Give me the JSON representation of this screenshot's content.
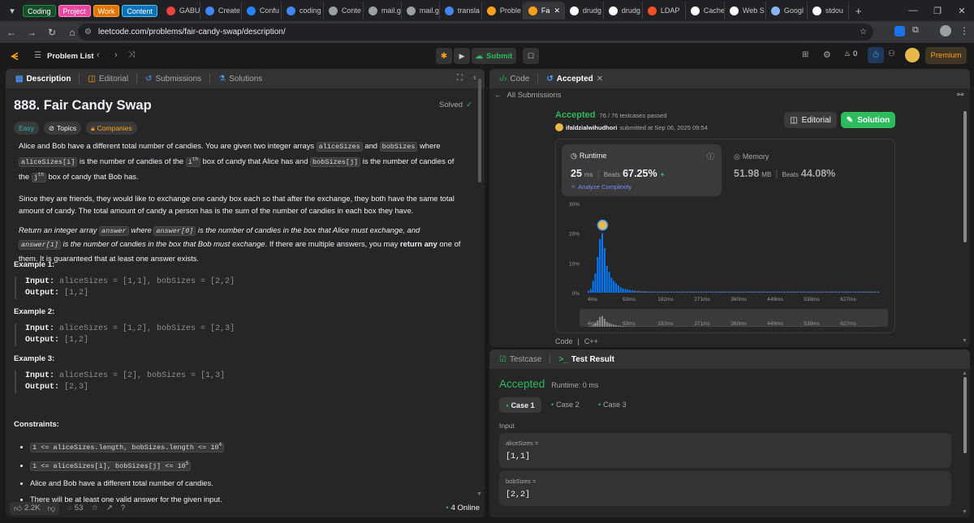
{
  "browser": {
    "tab_groups": [
      {
        "label": "Coding",
        "color": "#1e8e3e",
        "bg": "#174c2c"
      },
      {
        "label": "Project",
        "color": "#ff8bcb",
        "bg": "#e8479f"
      },
      {
        "label": "Work",
        "color": "#f9a825",
        "bg": "#e37400"
      },
      {
        "label": "Content",
        "color": "#4fc3f7",
        "bg": "#0b72b8"
      }
    ],
    "tabs": [
      {
        "label": "GABUI",
        "icon": "mail-icon",
        "color": "#e8453c"
      },
      {
        "label": "Create",
        "icon": "globe-icon",
        "color": "#4285f4"
      },
      {
        "label": "Confu",
        "icon": "confluence-icon",
        "color": "#2684ff"
      },
      {
        "label": "coding",
        "icon": "coding-icon",
        "color": "#4285f4"
      },
      {
        "label": "Conte",
        "icon": "doc-icon",
        "color": "#9aa0a6"
      },
      {
        "label": "mail.g",
        "icon": "globe-icon",
        "color": "#9aa0a6"
      },
      {
        "label": "mail.g",
        "icon": "globe-icon",
        "color": "#9aa0a6"
      },
      {
        "label": "transla",
        "icon": "google-icon",
        "color": "#4285f4"
      },
      {
        "label": "Proble",
        "icon": "leetcode-icon",
        "color": "#ffa116"
      },
      {
        "label": "Fa",
        "icon": "leetcode-icon",
        "color": "#ffa116"
      },
      {
        "label": "drudg",
        "icon": "github-icon",
        "color": "#ffffff"
      },
      {
        "label": "drudg",
        "icon": "github-icon",
        "color": "#ffffff"
      },
      {
        "label": "LDAP",
        "icon": "ms-icon",
        "color": "#f25022"
      },
      {
        "label": "Cache",
        "icon": "medium-icon",
        "color": "#ffffff"
      },
      {
        "label": "Web S",
        "icon": "medium-icon",
        "color": "#ffffff"
      },
      {
        "label": "Googl",
        "icon": "gemini-icon",
        "color": "#8ab4f8"
      },
      {
        "label": "stdou",
        "icon": "github-icon",
        "color": "#ffffff"
      }
    ],
    "url": "leetcode.com/problems/fair-candy-swap/description/"
  },
  "lc_nav": {
    "problem_list": "Problem List",
    "submit": "Submit",
    "streak": "0",
    "premium": "Premium"
  },
  "left_panel": {
    "tabs": [
      "Description",
      "Editorial",
      "Submissions",
      "Solutions"
    ],
    "title": "888. Fair Candy Swap",
    "solved": "Solved",
    "difficulty": "Easy",
    "topics": "Topics",
    "companies": "Companies",
    "p1": {
      "a": "Alice and Bob have a different total number of candies. You are given two integer arrays ",
      "c1": "aliceSizes",
      "b": " and ",
      "c2": "bobSizes",
      "c": " where ",
      "c3": "aliceSizes[i]",
      "d": " is",
      "e": "the number of candies of the ",
      "sup1": "i",
      "sup1b": "th",
      "f": " box of candy that Alice has and ",
      "c4": "bobSizes[j]",
      "g": " is the number of candies of the ",
      "sup2": "j",
      "sup2b": "th",
      "h": " box of candy that Bob has."
    },
    "p2": "Since they are friends, they would like to exchange one candy box each so that after the exchange, they both have the same total amount of candy. The total amount of candy a person has is the sum of the number of candies in each box they have.",
    "p3": {
      "a": "Return an integer array ",
      "c1": "answer",
      "b": " where ",
      "c2": "answer[0]",
      "c": " is the number of candies in the box that Alice must exchange, and ",
      "c3": "answer[1]",
      "d": " is the number of",
      "e": "candies in the box that Bob must exchange",
      "f": ". If there are multiple answers, you may ",
      "g": "return any",
      "h": " one of them. It is guaranteed that at least one answer exists."
    },
    "examples": [
      {
        "title": "Example 1:",
        "input_label": "Input:",
        "input": "aliceSizes = [1,1], bobSizes = [2,2]",
        "output_label": "Output:",
        "output": "[1,2]"
      },
      {
        "title": "Example 2:",
        "input_label": "Input:",
        "input": "aliceSizes = [1,2], bobSizes = [2,3]",
        "output_label": "Output:",
        "output": "[1,2]"
      },
      {
        "title": "Example 3:",
        "input_label": "Input:",
        "input": "aliceSizes = [2], bobSizes = [1,3]",
        "output_label": "Output:",
        "output": "[2,3]"
      }
    ],
    "constraints_title": "Constraints:",
    "constraints": [
      {
        "code": "1 <= aliceSizes.length, bobSizes.length <= 10",
        "sup": "4"
      },
      {
        "code": "1 <= aliceSizes[i], bobSizes[j] <= 10",
        "sup": "5"
      },
      {
        "text": "Alice and Bob have a different total number of candies."
      },
      {
        "text": "There will be at least one valid answer for the given input."
      }
    ],
    "footer": {
      "likes": "2.2K",
      "comments": "53",
      "online": "4 Online"
    }
  },
  "right_top": {
    "tabs": [
      "Code",
      "Accepted"
    ],
    "back": "All Submissions",
    "status": "Accepted",
    "passed": "76 / 76 testcases passed",
    "user": "ifaldzialwihudhori",
    "submitted": "submitted at Sep 06, 2025 09:54",
    "editorial": "Editorial",
    "solution": "Solution",
    "runtime": {
      "label": "Runtime",
      "value": "25",
      "unit": "ms",
      "beats_label": "Beats",
      "beats": "67.25%",
      "analyze": "Analyze Complexity"
    },
    "memory": {
      "label": "Memory",
      "value": "51.98",
      "unit": "MB",
      "beats_label": "Beats",
      "beats": "44.08%"
    },
    "code_label": "Code",
    "lang": "C++"
  },
  "chart_data": {
    "type": "bar",
    "ylabel": "",
    "ytick_labels": [
      "30%",
      "20%",
      "10%",
      "0%"
    ],
    "ylim": [
      0,
      30
    ],
    "xtick_labels": [
      "4ms",
      "93ms",
      "182ms",
      "271ms",
      "360ms",
      "449ms",
      "538ms",
      "627ms"
    ],
    "highlight": "25ms",
    "values": [
      0.6,
      1.2,
      4,
      6.5,
      12,
      18,
      20,
      15,
      9,
      7,
      5,
      4,
      3.2,
      2.5,
      1.8,
      1.4,
      1.2,
      1,
      0.9,
      0.8,
      0.7,
      0.6,
      0.6,
      0.5,
      0.5,
      0.5,
      0.4,
      0.4,
      0.4,
      0.4,
      0.4,
      0.4,
      0.4,
      0.4,
      0.4,
      0.4,
      0.4,
      0.4,
      0.4,
      0.4,
      0.4,
      0.4,
      0.4,
      0.4,
      0.4,
      0.4,
      0.4,
      0.4,
      0.4,
      0.4,
      0.4,
      0.4,
      0.4,
      0.4,
      0.4,
      0.4,
      0.4,
      0.4,
      0.4,
      0.4,
      0.4,
      0.4,
      0.4,
      0.4,
      0.4,
      0.4,
      0.4,
      0.4,
      0.4,
      0.4,
      0.4,
      0.4,
      0.4,
      0.4,
      0.4,
      0.4,
      0.4,
      0.4,
      0.4,
      0.4,
      0.4,
      0.4,
      0.4,
      0.4,
      0.4,
      0.4,
      0.4,
      0.4,
      0.4,
      0.4,
      0.4,
      0.4,
      0.4,
      0.4,
      0.4,
      0.4,
      0.4,
      0.4,
      0.4,
      0.4,
      0.4,
      0.4,
      0.4,
      0.4,
      0.4,
      0.4,
      0.4,
      0.4,
      0.4,
      0.4,
      0.4,
      0.4,
      0.4,
      0.4,
      0.4,
      0.4,
      0.4,
      0.4,
      0.4,
      0.4,
      0.4,
      0.4,
      0.4,
      0.4,
      0.4,
      0.4,
      0.4
    ],
    "highlight_index": 6,
    "bar_color": "#007aff",
    "tail_color": "#4a6fa5"
  },
  "right_bottom": {
    "tabs": [
      "Testcase",
      "Test Result"
    ],
    "status": "Accepted",
    "runtime": "Runtime: 0 ms",
    "cases": [
      "Case 1",
      "Case 2",
      "Case 3"
    ],
    "input_label": "Input",
    "inputs": [
      {
        "name": "aliceSizes =",
        "value": "[1,1]"
      },
      {
        "name": "bobSizes =",
        "value": "[2,2]"
      }
    ]
  }
}
